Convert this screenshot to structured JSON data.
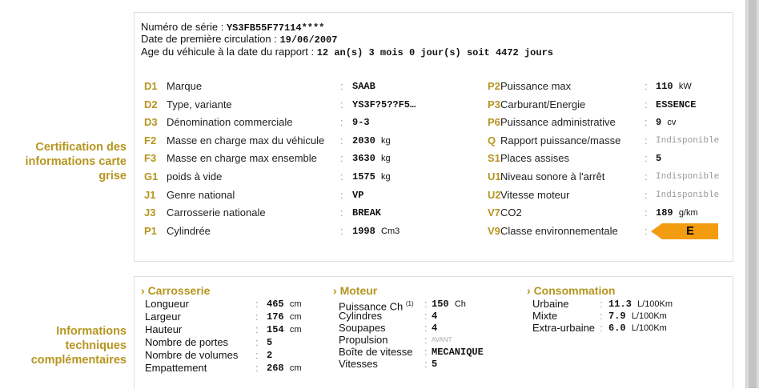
{
  "sections": {
    "certification_label": "Certification des informations carte grise",
    "technical_label": "Informations techniques complémentaires"
  },
  "header": {
    "serial_label": "Numéro de série :",
    "serial_value": "YS3FB55F77114****",
    "first_registration_label": "Date de première circulation :",
    "first_registration_value": "19/06/2007",
    "vehicle_age_label": "Age du véhicule à la date du rapport :",
    "vehicle_age_value": "12 an(s) 3 mois 0 jour(s) soit 4472 jours"
  },
  "left_fields": [
    {
      "code": "D1",
      "label": "Marque",
      "value": "SAAB",
      "unit": ""
    },
    {
      "code": "D2",
      "label": "Type, variante",
      "value": "YS3F?5??F5…",
      "unit": ""
    },
    {
      "code": "D3",
      "label": "Dénomination commerciale",
      "value": "9-3",
      "unit": ""
    },
    {
      "code": "F2",
      "label": "Masse en charge max du véhicule",
      "value": "2030",
      "unit": "kg"
    },
    {
      "code": "F3",
      "label": "Masse en charge max ensemble",
      "value": "3630",
      "unit": "kg"
    },
    {
      "code": "G1",
      "label": "poids à vide",
      "value": "1575",
      "unit": "kg"
    },
    {
      "code": "J1",
      "label": "Genre national",
      "value": "VP",
      "unit": ""
    },
    {
      "code": "J3",
      "label": "Carrosserie nationale",
      "value": "BREAK",
      "unit": ""
    },
    {
      "code": "P1",
      "label": "Cylindrée",
      "value": "1998",
      "unit": "Cm3"
    }
  ],
  "right_fields": [
    {
      "code": "P2",
      "label": "Puissance max",
      "value": "110",
      "unit": "kW"
    },
    {
      "code": "P3",
      "label": "Carburant/Energie",
      "value": "ESSENCE",
      "unit": ""
    },
    {
      "code": "P6",
      "label": "Puissance administrative",
      "value": "9",
      "unit": "cv"
    },
    {
      "code": "Q",
      "label": "Rapport puissance/masse",
      "value": "Indisponible",
      "unit": ""
    },
    {
      "code": "S1",
      "label": "Places assises",
      "value": "5",
      "unit": ""
    },
    {
      "code": "U1",
      "label": "Niveau sonore à l'arrêt",
      "value": "Indisponible",
      "unit": ""
    },
    {
      "code": "U2",
      "label": "Vitesse moteur",
      "value": "Indisponible",
      "unit": ""
    },
    {
      "code": "V7",
      "label": "CO2",
      "value": "189",
      "unit": "g/km"
    },
    {
      "code": "V9",
      "label": "Classe environnementale",
      "value": "E",
      "unit": ""
    }
  ],
  "eco_color": "#f39c12",
  "accent_color": "#b6951f",
  "carrosserie": {
    "title": "Carrosserie",
    "rows": [
      {
        "label": "Longueur",
        "value": "465",
        "unit": "cm"
      },
      {
        "label": "Largeur",
        "value": "176",
        "unit": "cm"
      },
      {
        "label": "Hauteur",
        "value": "154",
        "unit": "cm"
      },
      {
        "label": "Nombre de portes",
        "value": "5",
        "unit": ""
      },
      {
        "label": "Nombre de volumes",
        "value": "2",
        "unit": ""
      },
      {
        "label": "Empattement",
        "value": "268",
        "unit": "cm"
      }
    ]
  },
  "moteur": {
    "title": "Moteur",
    "rows": [
      {
        "label": "Puissance Ch",
        "sup": "(1)",
        "value": "150",
        "unit": "Ch"
      },
      {
        "label": "Cylindres",
        "sup": "",
        "value": "4",
        "unit": ""
      },
      {
        "label": "Soupapes",
        "sup": "",
        "value": "4",
        "unit": ""
      },
      {
        "label": "Propulsion",
        "sup": "",
        "value": "AVANT",
        "unit": ""
      },
      {
        "label": "Boîte de vitesse",
        "sup": "",
        "value": "MECANIQUE",
        "unit": ""
      },
      {
        "label": "Vitesses",
        "sup": "",
        "value": "5",
        "unit": ""
      }
    ]
  },
  "consommation": {
    "title": "Consommation",
    "rows": [
      {
        "label": "Urbaine",
        "value": "11.3",
        "unit": "L/100Km"
      },
      {
        "label": "Mixte",
        "value": "7.9",
        "unit": "L/100Km"
      },
      {
        "label": "Extra-urbaine",
        "value": "6.0",
        "unit": "L/100Km"
      }
    ]
  }
}
